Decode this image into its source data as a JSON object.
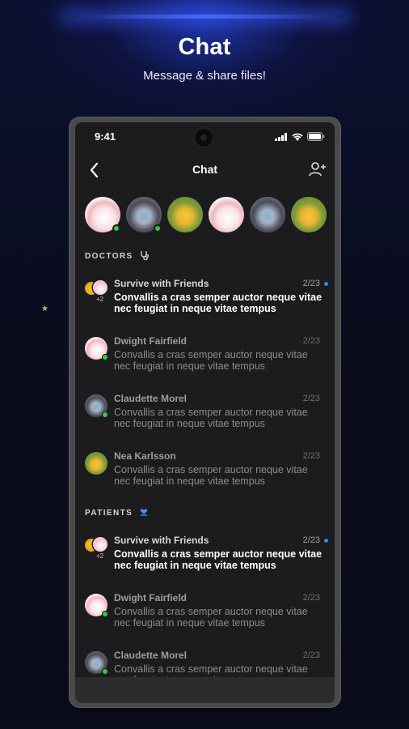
{
  "hero": {
    "title": "Chat",
    "subtitle": "Message & share files!"
  },
  "status_bar": {
    "time": "9:41"
  },
  "nav": {
    "title": "Chat"
  },
  "stories": [
    {
      "style": "pink",
      "online": true
    },
    {
      "style": "gray",
      "online": true
    },
    {
      "style": "green",
      "online": false
    },
    {
      "style": "pink",
      "online": false
    },
    {
      "style": "gray",
      "online": false
    },
    {
      "style": "green",
      "online": false
    }
  ],
  "sections": [
    {
      "label": "DOCTORS",
      "icon": "stethoscope-icon",
      "chats": [
        {
          "name": "Survive with Friends",
          "date": "2/23",
          "message": "Convallis a cras semper auctor neque vitae nec feugiat in neque vitae tempus",
          "unread": true,
          "group": true,
          "extra": "+2"
        },
        {
          "name": "Dwight Fairfield",
          "date": "2/23",
          "message": "Convallis a cras semper auctor neque vitae nec feugiat in neque vitae tempus",
          "unread": false,
          "avatar": "pink",
          "online": true
        },
        {
          "name": "Claudette Morel",
          "date": "2/23",
          "message": "Convallis a cras semper auctor neque vitae nec feugiat in neque vitae tempus",
          "unread": false,
          "avatar": "gray",
          "online": true
        },
        {
          "name": "Nea Karlsson",
          "date": "2/23",
          "message": "Convallis a cras semper auctor neque vitae nec feugiat in neque vitae tempus",
          "unread": false,
          "avatar": "green",
          "online": false
        }
      ]
    },
    {
      "label": "PATIENTS",
      "icon": "heart-hand-icon",
      "chats": [
        {
          "name": "Survive with Friends",
          "date": "2/23",
          "message": "Convallis a cras semper auctor neque vitae nec feugiat in neque vitae tempus",
          "unread": true,
          "group": true,
          "extra": "+2"
        },
        {
          "name": "Dwight Fairfield",
          "date": "2/23",
          "message": "Convallis a cras semper auctor neque vitae nec feugiat in neque vitae tempus",
          "unread": false,
          "avatar": "pink",
          "online": true
        },
        {
          "name": "Claudette Morel",
          "date": "2/23",
          "message": "Convallis a cras semper auctor neque vitae nec feugiat in neque vitae tempus",
          "unread": false,
          "avatar": "gray",
          "online": true
        }
      ]
    }
  ],
  "colors": {
    "accent": "#2e88ff",
    "online": "#2ecc40",
    "background": "#1c1c1e"
  }
}
